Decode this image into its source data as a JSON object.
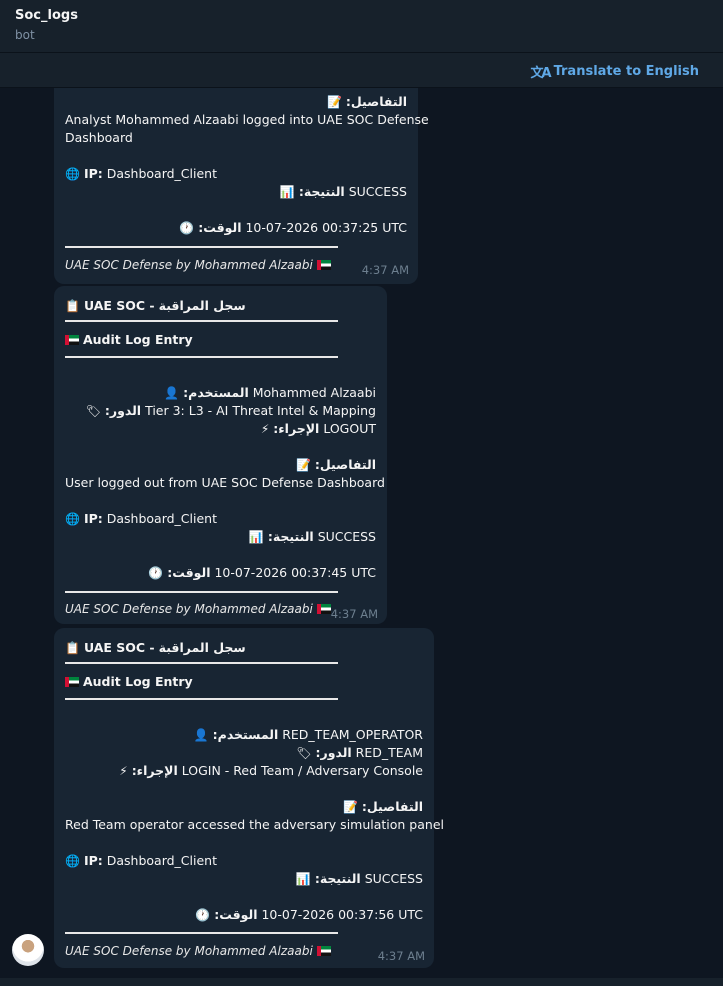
{
  "header": {
    "title": "Soc_logs",
    "subtitle": "bot"
  },
  "translate": {
    "label": "Translate to English",
    "icon": "translate-icon"
  },
  "messages": [
    {
      "details_label": "التفاصيل:",
      "details_text_1": "Analyst Mohammed Alzaabi logged into UAE SOC Defense",
      "details_text_2": "Dashboard",
      "ip_label": "IP:",
      "ip_value": "Dashboard_Client",
      "result_label": "النتيجة:",
      "result_value": "SUCCESS",
      "time_label": "الوقت:",
      "time_value": "10-07-2026 00:37:25 UTC",
      "footer": "UAE SOC Defense by Mohammed Alzaabi",
      "sent_time": "4:37 AM"
    },
    {
      "header_ar": "سجل المراقبة",
      "header_en": "UAE SOC -",
      "subheader": "Audit Log Entry",
      "user_label": "المستخدم:",
      "user_value": "Mohammed Alzaabi",
      "role_label": "الدور:",
      "role_value": "Tier 3: L3 - AI Threat Intel & Mapping",
      "action_label": "الإجراء:",
      "action_value": "LOGOUT",
      "details_label": "التفاصيل:",
      "details_text": "User logged out from UAE SOC Defense Dashboard",
      "ip_label": "IP:",
      "ip_value": "Dashboard_Client",
      "result_label": "النتيجة:",
      "result_value": "SUCCESS",
      "time_label": "الوقت:",
      "time_value": "10-07-2026 00:37:45 UTC",
      "footer": "UAE SOC Defense by Mohammed Alzaabi",
      "sent_time": "4:37 AM"
    },
    {
      "header_ar": "سجل المراقبة",
      "header_en": "UAE SOC -",
      "subheader": "Audit Log Entry",
      "user_label": "المستخدم:",
      "user_value": "RED_TEAM_OPERATOR",
      "role_label": "الدور:",
      "role_value": "RED_TEAM",
      "action_label": "الإجراء:",
      "action_value": "LOGIN - Red Team / Adversary Console",
      "details_label": "التفاصيل:",
      "details_text": "Red Team operator accessed the adversary simulation panel",
      "ip_label": "IP:",
      "ip_value": "Dashboard_Client",
      "result_label": "النتيجة:",
      "result_value": "SUCCESS",
      "time_label": "الوقت:",
      "time_value": "10-07-2026 00:37:56 UTC",
      "footer": "UAE SOC Defense by Mohammed Alzaabi",
      "sent_time": "4:37 AM"
    }
  ],
  "colors": {
    "background": "#0e1621",
    "bubble": "#182533",
    "accent": "#5fa8e6",
    "header": "#17212b"
  }
}
